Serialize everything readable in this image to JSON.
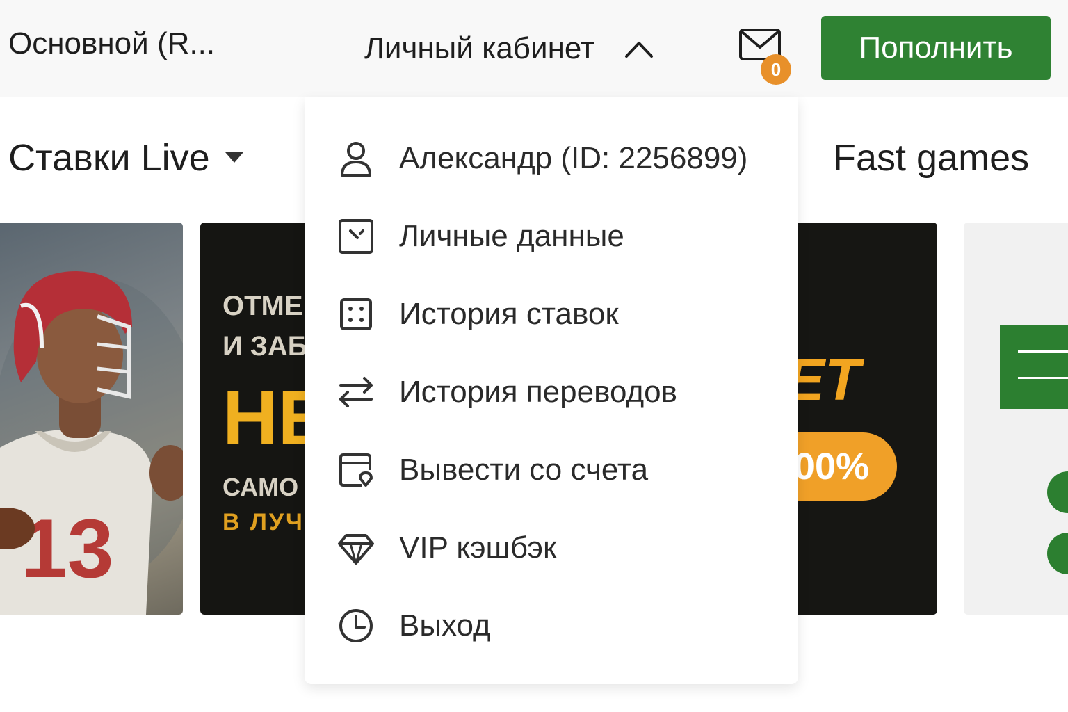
{
  "header": {
    "account_selector": "Основной (R...",
    "cabinet_label": "Личный кабинет",
    "messages_count": "0",
    "deposit_label": "Пополнить"
  },
  "nav": {
    "live_label": "Ставки Live",
    "fast_games_label": "Fast games"
  },
  "banners": {
    "b2_line1": "ОТМЕ",
    "b2_line2": "И ЗАБ",
    "b2_line3": "НЕ",
    "b2_line4": "САМО",
    "b2_line5": "В ЛУЧ",
    "b3_brand": "ET",
    "b3_pill": "00%",
    "jersey_number": "13"
  },
  "account_menu": {
    "items": [
      {
        "label": "Александр (ID: 2256899)",
        "icon": "user-icon"
      },
      {
        "label": "Личные данные",
        "icon": "personal-data-icon"
      },
      {
        "label": "История ставок",
        "icon": "bet-history-icon"
      },
      {
        "label": "История переводов",
        "icon": "transfer-arrows-icon"
      },
      {
        "label": "Вывести со счета",
        "icon": "withdraw-icon"
      },
      {
        "label": "VIP кэшбэк",
        "icon": "diamond-icon"
      },
      {
        "label": "Выход",
        "icon": "clock-icon"
      }
    ]
  },
  "colors": {
    "accent_green": "#2f8233",
    "badge_orange": "#e8902a",
    "header_bg": "#f8f8f8"
  }
}
